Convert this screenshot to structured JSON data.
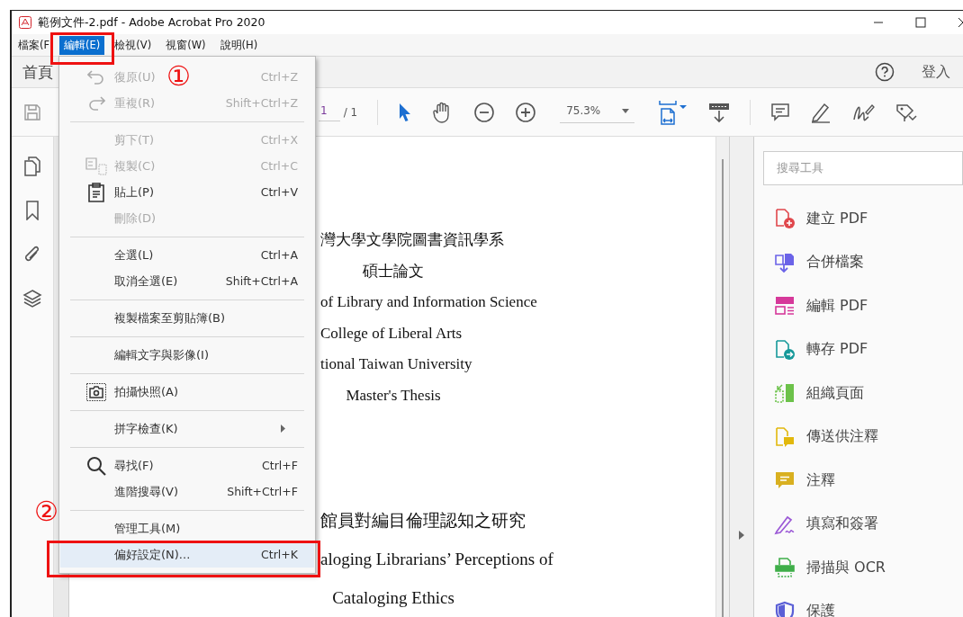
{
  "window": {
    "title": "範例文件-2.pdf - Adobe Acrobat Pro 2020"
  },
  "menubar": [
    {
      "label": "檔案(F",
      "selected": false
    },
    {
      "label": "編輯(E)",
      "selected": true
    },
    {
      "label": "檢視(V)",
      "selected": false
    },
    {
      "label": "視窗(W)",
      "selected": false
    },
    {
      "label": "說明(H)",
      "selected": false
    }
  ],
  "tabbar": {
    "home_tab": "首頁",
    "sign_in": "登入"
  },
  "toolbar": {
    "page_number": "1",
    "page_total": "/ 1",
    "zoom": "75.3%"
  },
  "edit_menu": {
    "groups": [
      [
        {
          "label": "復原(U)",
          "shortcut": "Ctrl+Z",
          "disabled": true,
          "selected": false,
          "submenu": false
        },
        {
          "label": "重複(R)",
          "shortcut": "Shift+Ctrl+Z",
          "disabled": true,
          "selected": false,
          "submenu": false
        }
      ],
      [
        {
          "label": "剪下(T)",
          "shortcut": "Ctrl+X",
          "disabled": true,
          "selected": false,
          "submenu": false
        },
        {
          "label": "複製(C)",
          "shortcut": "Ctrl+C",
          "disabled": true,
          "selected": false,
          "submenu": false
        },
        {
          "label": "貼上(P)",
          "shortcut": "Ctrl+V",
          "disabled": false,
          "selected": false,
          "submenu": false
        },
        {
          "label": "刪除(D)",
          "disabled": true,
          "selected": false,
          "submenu": false
        }
      ],
      [
        {
          "label": "全選(L)",
          "shortcut": "Ctrl+A",
          "disabled": false,
          "selected": false,
          "submenu": false
        },
        {
          "label": "取消全選(E)",
          "shortcut": "Shift+Ctrl+A",
          "disabled": false,
          "selected": false,
          "submenu": false
        }
      ],
      [
        {
          "label": "複製檔案至剪貼簿(B)",
          "disabled": false,
          "selected": false,
          "submenu": false
        }
      ],
      [
        {
          "label": "編輯文字與影像(I)",
          "disabled": false,
          "selected": false,
          "submenu": false
        }
      ],
      [
        {
          "label": "拍攝快照(A)",
          "disabled": false,
          "selected": false,
          "submenu": false
        }
      ],
      [
        {
          "label": "拼字檢查(K)",
          "disabled": false,
          "selected": false,
          "submenu": true
        }
      ],
      [
        {
          "label": "尋找(F)",
          "shortcut": "Ctrl+F",
          "disabled": false,
          "selected": false,
          "submenu": false
        },
        {
          "label": "進階搜尋(V)",
          "shortcut": "Shift+Ctrl+F",
          "disabled": false,
          "selected": false,
          "submenu": false
        }
      ],
      [
        {
          "label": "管理工具(M)",
          "disabled": false,
          "selected": false,
          "submenu": false
        },
        {
          "label": "偏好設定(N)...",
          "shortcut": "Ctrl+K",
          "disabled": false,
          "selected": true,
          "submenu": false
        }
      ]
    ]
  },
  "document": {
    "sections": [
      [
        {
          "text": "灣大學文學院圖書資訊學系",
          "kind": "cut"
        },
        {
          "text": "碩士論文",
          "kind": "full"
        },
        {
          "text": "of Library and Information Science",
          "kind": "cut"
        },
        {
          "text": "College of Liberal Arts",
          "kind": "cut"
        },
        {
          "text": "tional Taiwan University",
          "kind": "cut"
        },
        {
          "text": "Master's Thesis",
          "kind": "full"
        }
      ],
      [
        {
          "text": "館員對編目倫理認知之研究",
          "kind": "cut"
        },
        {
          "text": "aloging Librarians’ Perceptions of",
          "kind": "cut"
        },
        {
          "text": "Cataloging Ethics",
          "kind": "full"
        }
      ]
    ]
  },
  "tools_panel": {
    "search": {
      "placeholder": "搜尋工具"
    },
    "tools": [
      {
        "label": "建立 PDF",
        "color": "#e0474c"
      },
      {
        "label": "合併檔案",
        "color": "#6b63e8"
      },
      {
        "label": "編輯 PDF",
        "color": "#d6399a"
      },
      {
        "label": "轉存 PDF",
        "color": "#16999a"
      },
      {
        "label": "組織頁面",
        "color": "#6cc24a"
      },
      {
        "label": "傳送供注釋",
        "color": "#e2b80c"
      },
      {
        "label": "注釋",
        "color": "#d9b020"
      },
      {
        "label": "填寫和簽署",
        "color": "#9b59d6"
      },
      {
        "label": "掃描與 OCR",
        "color": "#3fae49"
      },
      {
        "label": "保護",
        "color": "#5a5fd6"
      }
    ]
  },
  "annotations": [
    {
      "label": "①"
    },
    {
      "label": "②"
    }
  ]
}
